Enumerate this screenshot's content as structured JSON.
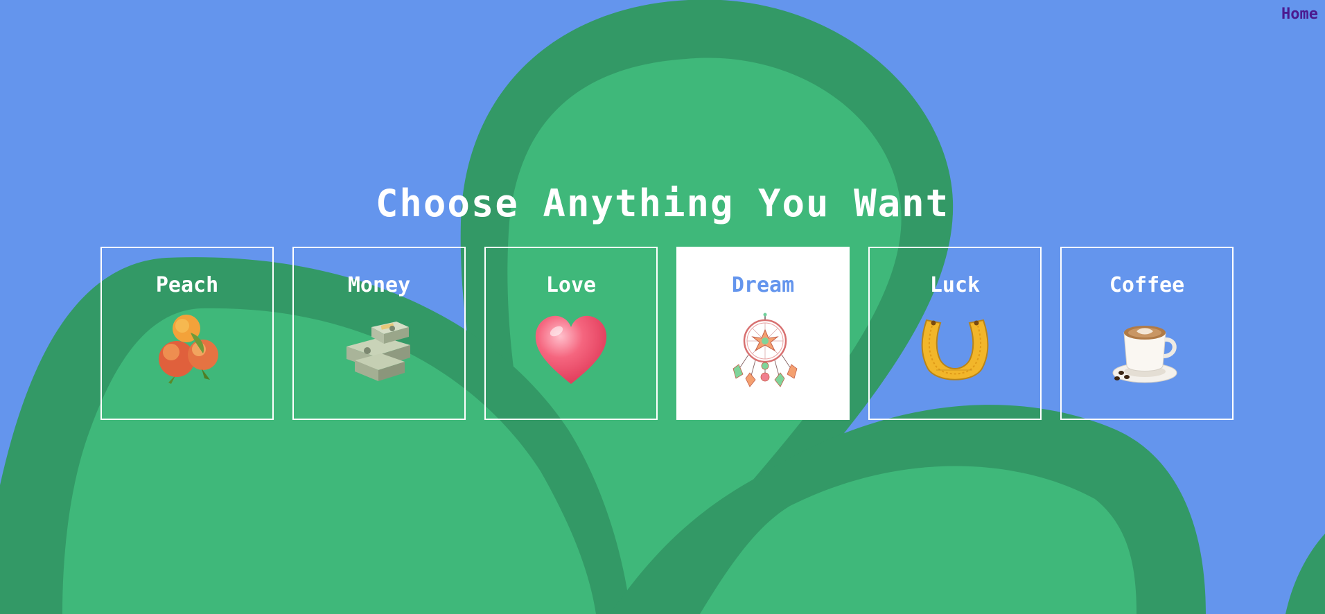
{
  "nav": {
    "home_label": "Home"
  },
  "page": {
    "title": "Choose Anything You Want"
  },
  "colors": {
    "background": "#6495ED",
    "shape_dark": "#339966",
    "shape_light": "#3fb87a",
    "text": "#ffffff",
    "home_link": "#4b1a8f"
  },
  "cards": [
    {
      "label": "Peach",
      "icon": "peach-icon",
      "selected": false
    },
    {
      "label": "Money",
      "icon": "money-stack-icon",
      "selected": false
    },
    {
      "label": "Love",
      "icon": "heart-icon",
      "selected": false
    },
    {
      "label": "Dream",
      "icon": "dreamcatcher-icon",
      "selected": true
    },
    {
      "label": "Luck",
      "icon": "horseshoe-icon",
      "selected": false
    },
    {
      "label": "Coffee",
      "icon": "coffee-cup-icon",
      "selected": false
    }
  ]
}
